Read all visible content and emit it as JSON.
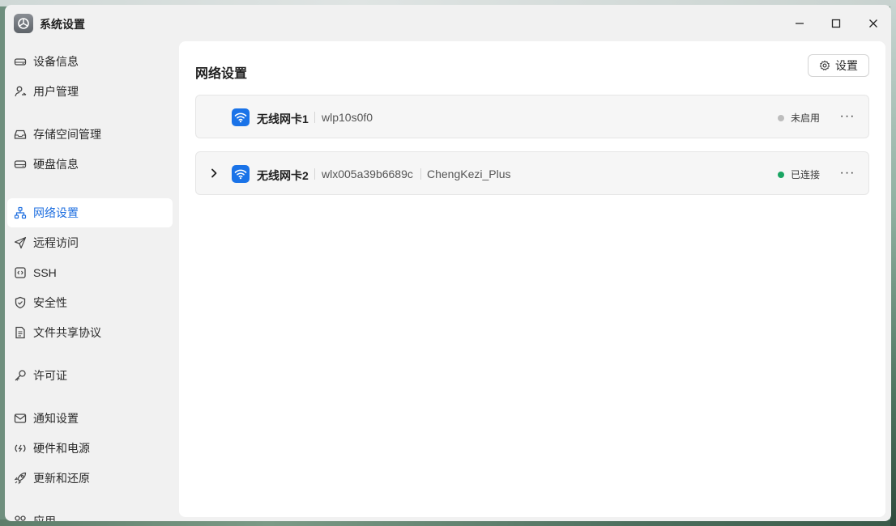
{
  "window": {
    "title": "系统设置"
  },
  "sidebar": {
    "items": [
      {
        "label": "设备信息",
        "icon": "device-icon"
      },
      {
        "label": "用户管理",
        "icon": "user-icon"
      },
      {
        "label": "存储空间管理",
        "icon": "storage-icon"
      },
      {
        "label": "硬盘信息",
        "icon": "disk-icon"
      },
      {
        "label": "网络设置",
        "icon": "network-icon",
        "active": true
      },
      {
        "label": "远程访问",
        "icon": "send-icon"
      },
      {
        "label": "SSH",
        "icon": "terminal-icon"
      },
      {
        "label": "安全性",
        "icon": "shield-icon"
      },
      {
        "label": "文件共享协议",
        "icon": "document-icon"
      },
      {
        "label": "许可证",
        "icon": "key-icon"
      },
      {
        "label": "通知设置",
        "icon": "mail-icon"
      },
      {
        "label": "硬件和电源",
        "icon": "power-icon"
      },
      {
        "label": "更新和还原",
        "icon": "rocket-icon"
      },
      {
        "label": "应用",
        "icon": "apps-icon"
      }
    ]
  },
  "main": {
    "title": "网络设置",
    "settings_label": "设置",
    "cards": [
      {
        "name": "无线网卡1",
        "interface": "wlp10s0f0",
        "ssid": "",
        "status": "未启用",
        "status_color": "#bdbdbd",
        "expandable": false
      },
      {
        "name": "无线网卡2",
        "interface": "wlx005a39b6689c",
        "ssid": "ChengKezi_Plus",
        "status": "已连接",
        "status_color": "#1aa563",
        "expandable": true
      }
    ],
    "more_label": "···"
  },
  "colors": {
    "accent": "#1f6fe0",
    "wifi_badge": "#1a73e8"
  }
}
